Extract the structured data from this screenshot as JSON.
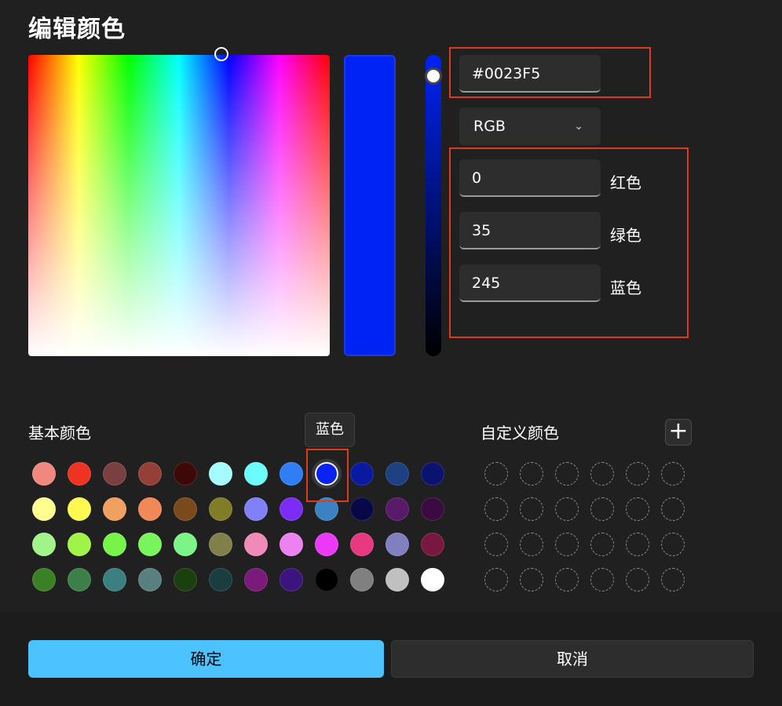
{
  "dialog": {
    "title": "编辑颜色",
    "ok_label": "确定",
    "cancel_label": "取消"
  },
  "color": {
    "hex": "#0023F5",
    "mode": "RGB",
    "mode_icon": "chevron-down-icon",
    "channels": [
      {
        "label": "红色",
        "value": "0"
      },
      {
        "label": "绿色",
        "value": "35"
      },
      {
        "label": "蓝色",
        "value": "245"
      }
    ]
  },
  "basic_colors": {
    "label": "基本颜色",
    "tooltip": "蓝色",
    "rows": [
      [
        "#f08880",
        "#ee3322",
        "#7a4040",
        "#944038",
        "#3d0808",
        "#a6fcfc",
        "#6cfcfc",
        "#2f7ef5",
        "#0a23f5",
        "#0a1aa0",
        "#1d4082",
        "#0a1470"
      ],
      [
        "#fefe90",
        "#fdf950",
        "#f0a060",
        "#f08858",
        "#7a4a1c",
        "#807c28",
        "#8080f8",
        "#7a2ef5",
        "#3a82c2",
        "#080848",
        "#5a1a6a",
        "#3a0a40"
      ],
      [
        "#a0f48a",
        "#a0f448",
        "#78f448",
        "#78f45c",
        "#7cf488",
        "#80804a",
        "#f08ab8",
        "#ec82f0",
        "#ea3af5",
        "#e83880",
        "#8080c0",
        "#781840"
      ],
      [
        "#3a8024",
        "#3a8048",
        "#3a8080",
        "#588080",
        "#1a4010",
        "#1a3e40",
        "#7a1a7a",
        "#3c147e",
        "#000000",
        "#808080",
        "#c0c0c0",
        "#ffffff"
      ]
    ]
  },
  "custom_colors": {
    "label": "自定义颜色",
    "add_icon": "plus-icon"
  }
}
